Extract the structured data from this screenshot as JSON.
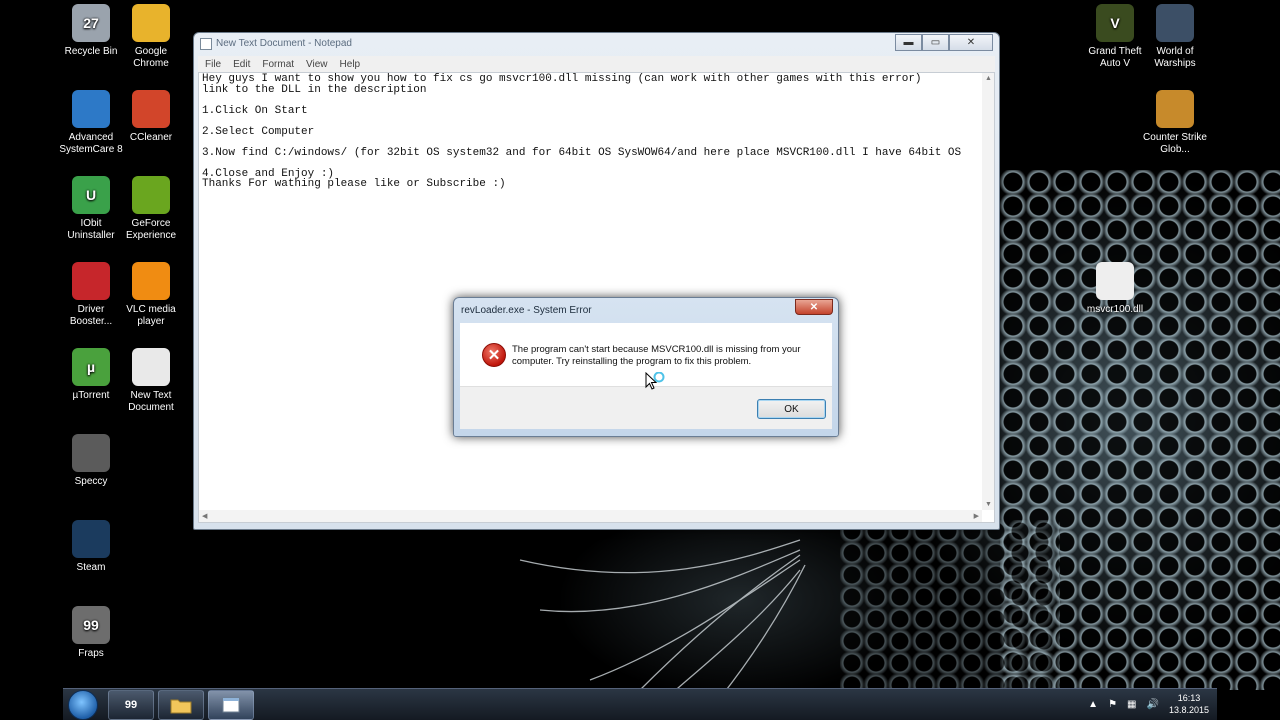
{
  "desktop": {
    "icons_left": [
      {
        "label": "Recycle Bin",
        "badge": "27",
        "color": "#9aa3ad"
      },
      {
        "label": "Google Chrome",
        "badge": "",
        "color": "#e8b32c"
      },
      {
        "label": "Advanced SystemCare 8",
        "badge": "",
        "color": "#2d79c7"
      },
      {
        "label": "CCleaner",
        "badge": "",
        "color": "#d2452a"
      },
      {
        "label": "IObit Uninstaller",
        "badge": "U",
        "color": "#3aa14a"
      },
      {
        "label": "GeForce Experience",
        "badge": "",
        "color": "#6aa61f"
      },
      {
        "label": "Driver Booster...",
        "badge": "",
        "color": "#c6262b"
      },
      {
        "label": "VLC media player",
        "badge": "",
        "color": "#f08c12"
      },
      {
        "label": "µTorrent",
        "badge": "µ",
        "color": "#4aa13d"
      },
      {
        "label": "New Text Document",
        "badge": "",
        "color": "#e9e9e9"
      },
      {
        "label": "Speccy",
        "badge": "",
        "color": "#5b5b5b"
      },
      {
        "label": "Steam",
        "badge": "",
        "color": "#1b3b5e"
      },
      {
        "label": "Fraps",
        "badge": "99",
        "color": "#6d6d6d"
      }
    ],
    "icons_right": [
      {
        "label": "Grand Theft Auto V",
        "badge": "V",
        "color": "#3a4b1f"
      },
      {
        "label": "World of Warships",
        "badge": "",
        "color": "#3c4f66"
      },
      {
        "label": "Counter Strike Glob...",
        "badge": "",
        "color": "#c78a2b"
      },
      {
        "label": "msvcr100.dll",
        "badge": "",
        "color": "#eeeeee"
      }
    ]
  },
  "notepad": {
    "title": "New Text Document - Notepad",
    "menu": [
      "File",
      "Edit",
      "Format",
      "View",
      "Help"
    ],
    "content": "Hey guys I want to show you how to fix cs go msvcr100.dll missing (can work with other games with this error)\nlink to the DLL in the description\n\n1.Click On Start\n\n2.Select Computer\n\n3.Now find C:/windows/ (for 32bit OS system32 and for 64bit OS SysWOW64/and here place MSVCR100.dll I have 64bit OS\n\n4.Close and Enjoy :)\nThanks For wathing please like or Subscribe :)",
    "buttons": {
      "minimize": "▬",
      "maximize": "▭",
      "close": "✕"
    }
  },
  "dialog": {
    "title": "revLoader.exe - System Error",
    "message": "The program can't start because MSVCR100.dll is missing from your computer. Try reinstalling the program to fix this problem.",
    "ok_label": "OK",
    "close_label": "✕"
  },
  "taskbar": {
    "pinned": [
      {
        "name": "fraps",
        "badge": "99"
      },
      {
        "name": "explorer",
        "badge": ""
      },
      {
        "name": "notepad",
        "badge": ""
      }
    ],
    "clock_time": "16:13",
    "clock_date": "13.8.2015"
  }
}
